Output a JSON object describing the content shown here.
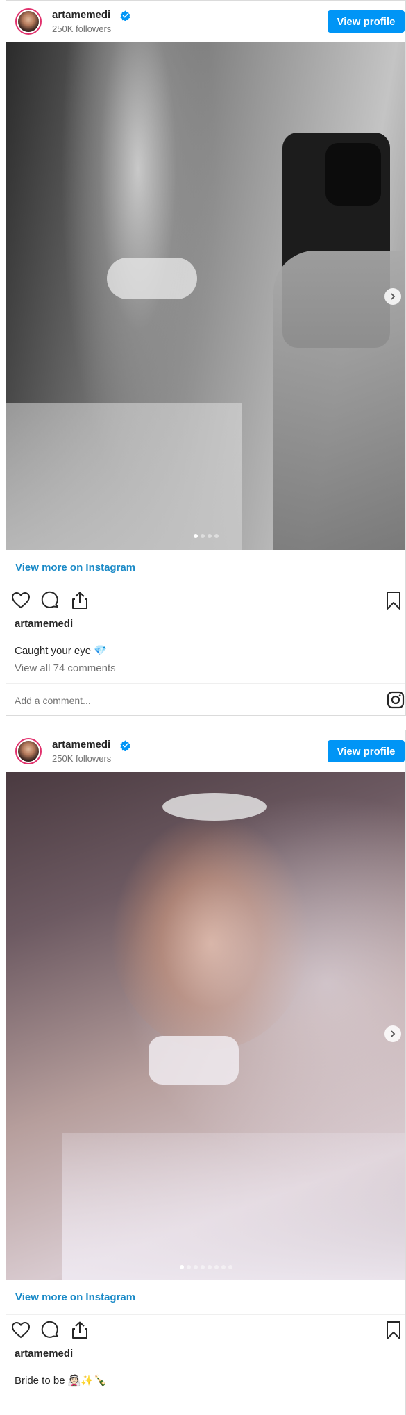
{
  "posts": [
    {
      "username": "artamemedi",
      "followers": "250K followers",
      "view_profile_label": "View profile",
      "view_more_label": "View more on Instagram",
      "post_username": "artamemedi",
      "caption": "Caught your eye 💎",
      "view_comments": "View all 74 comments",
      "add_comment_placeholder": "Add a comment...",
      "carousel": {
        "count": 4,
        "active": 1
      }
    },
    {
      "username": "artamemedi",
      "followers": "250K followers",
      "view_profile_label": "View profile",
      "view_more_label": "View more on Instagram",
      "post_username": "artamemedi",
      "caption": "Bride to be 👰🏻✨🍾",
      "carousel": {
        "count": 8,
        "active": 1
      }
    }
  ],
  "colors": {
    "accent": "#0095f6",
    "link": "#1a8ac7",
    "verified": "#0095f6"
  },
  "icons": [
    "verified-badge-icon",
    "heart-icon",
    "comment-icon",
    "share-icon",
    "bookmark-icon",
    "chevron-right-icon",
    "instagram-icon"
  ]
}
